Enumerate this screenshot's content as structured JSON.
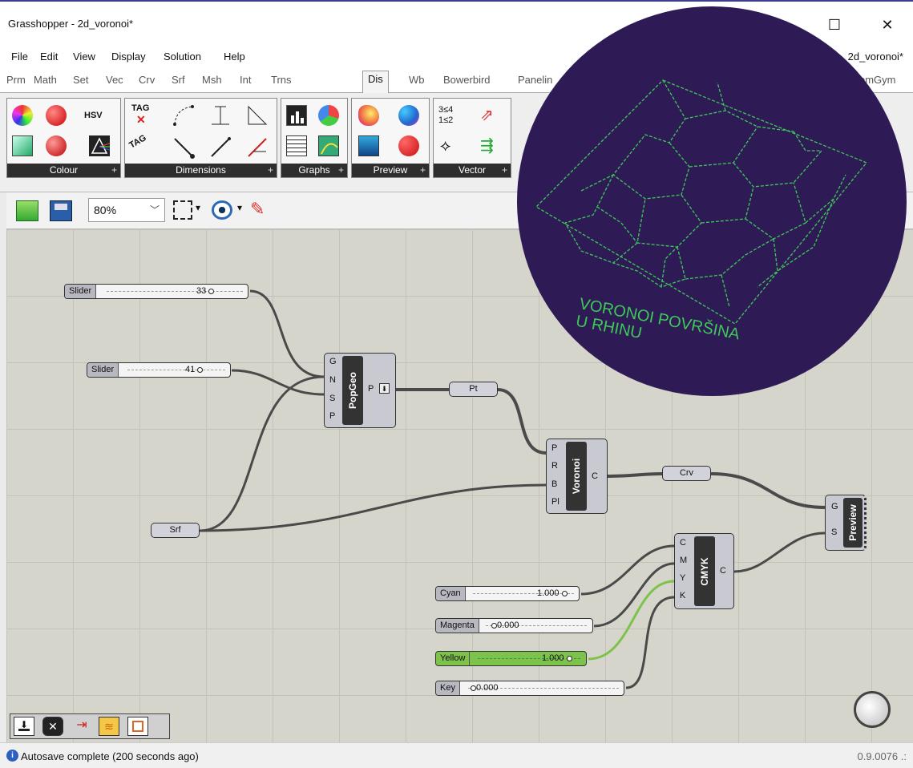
{
  "window": {
    "title": "Grasshopper - 2d_voronoi*",
    "minimize": "☐",
    "close": "✕"
  },
  "menu": [
    "File",
    "Edit",
    "View",
    "Display",
    "Solution",
    "Help"
  ],
  "doc_name": "2d_voronoi*",
  "tabs": [
    "Prm",
    "Math",
    "Set",
    "Vec",
    "Crv",
    "Srf",
    "Msh",
    "Int",
    "Trns",
    "Dis",
    "Wb",
    "Bowerbird",
    "Panelin",
    "omGym"
  ],
  "active_tab": "Dis",
  "ribbon_groups": [
    {
      "label": "Colour",
      "plus": "+"
    },
    {
      "label": "Dimensions",
      "plus": "+"
    },
    {
      "label": "Graphs",
      "plus": "+"
    },
    {
      "label": "Preview",
      "plus": "+"
    },
    {
      "label": "Vector",
      "plus": "+"
    }
  ],
  "ribbon_text": {
    "hsv": "HSV",
    "tag": "TAG",
    "ratio": "3≤4 1≤2"
  },
  "zoom": {
    "value": "80%",
    "chevron": "﹀"
  },
  "sliders": {
    "s1": {
      "label": "Slider",
      "value": "33"
    },
    "s2": {
      "label": "Slider",
      "value": "41"
    },
    "cyan": {
      "label": "Cyan",
      "value": "1.000"
    },
    "magenta": {
      "label": "Magenta",
      "value": "0.000"
    },
    "yellow": {
      "label": "Yellow",
      "value": "1.000"
    },
    "key": {
      "label": "Key",
      "value": "0.000"
    }
  },
  "components": {
    "popgeo": {
      "name": "PopGeo",
      "inputs": [
        "G",
        "N",
        "S",
        "P"
      ],
      "output": "P"
    },
    "voronoi": {
      "name": "Voronoi",
      "inputs": [
        "P",
        "R",
        "B",
        "Pl"
      ],
      "output": "C"
    },
    "cmyk": {
      "name": "CMYK",
      "inputs": [
        "C",
        "M",
        "Y",
        "K"
      ],
      "output": "C"
    },
    "preview": {
      "name": "Preview",
      "inputs": [
        "G",
        "S"
      ]
    }
  },
  "params": {
    "pt": "Pt",
    "crv": "Crv",
    "srf": "Srf"
  },
  "overlay": {
    "caption_line1": "VORONOI POVRŠINA",
    "caption_line2": "U RHINU"
  },
  "status": {
    "text": "Autosave complete (200 seconds ago)",
    "version": "0.9.0076",
    "grip": ".:",
    "info_glyph": "i"
  },
  "colors": {
    "accent": "#3d3b8f",
    "overlay_bg": "#2e1b55",
    "voronoi_green": "#3fc75a",
    "canvas": "#d6d5cc"
  }
}
